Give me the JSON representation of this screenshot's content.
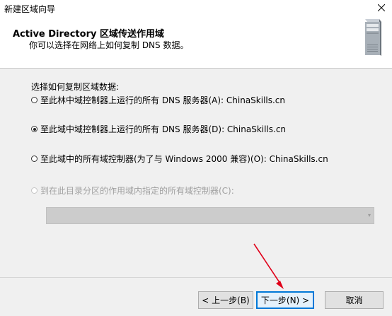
{
  "window": {
    "title": "新建区域向导"
  },
  "header": {
    "title": "Active Directory 区域传送作用域",
    "subtitle": "你可以选择在网络上如何复制 DNS 数据。"
  },
  "content": {
    "prompt": "选择如何复制区域数据:",
    "options": [
      {
        "label": "至此林中域控制器上运行的所有 DNS 服务器(A): ChinaSkills.cn",
        "checked": false,
        "enabled": true
      },
      {
        "label": "至此域中域控制器上运行的所有 DNS 服务器(D): ChinaSkills.cn",
        "checked": true,
        "enabled": true
      },
      {
        "label": "至此域中的所有域控制器(为了与 Windows 2000 兼容)(O): ChinaSkills.cn",
        "checked": false,
        "enabled": true
      },
      {
        "label": "到在此目录分区的作用域内指定的所有域控制器(C):",
        "checked": false,
        "enabled": false
      }
    ],
    "directory_partition": {
      "value": "",
      "enabled": false
    }
  },
  "buttons": {
    "back": "< 上一步(B)",
    "next": "下一步(N) >",
    "cancel": "取消"
  },
  "icons": {
    "close": "close-icon",
    "server": "server-icon",
    "chevron": "chevron-down-icon",
    "annotation": "red-arrow-icon"
  },
  "colors": {
    "focus_border": "#0078d7",
    "annotation_arrow": "#e0001a"
  }
}
